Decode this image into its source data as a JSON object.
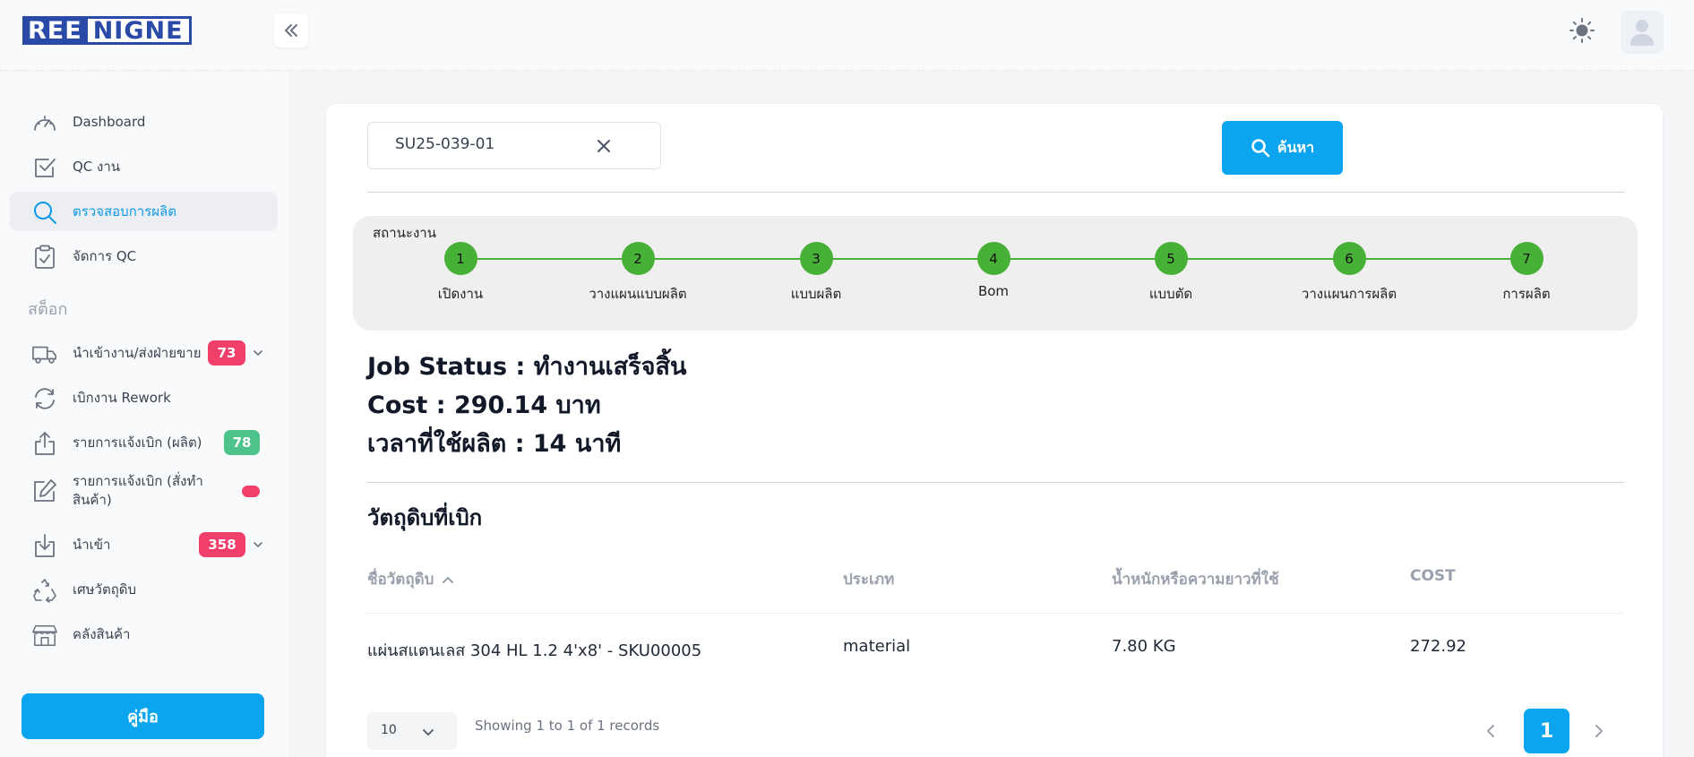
{
  "brand": {
    "logo_left": "REE",
    "logo_right": "NIGNE"
  },
  "sidebar": {
    "section_stock": "สต็อก",
    "items": [
      {
        "label": "Dashboard",
        "icon": "dashboard-gauge-icon"
      },
      {
        "label": "QC งาน",
        "icon": "checkbox-icon"
      },
      {
        "label": "ตรวจสอบการผลิต",
        "icon": "search-icon",
        "active": true
      },
      {
        "label": "จัดการ QC",
        "icon": "clipboard-icon"
      },
      {
        "label": "นำเข้างาน/ส่งฝ่ายขาย",
        "icon": "truck-icon",
        "badge": "73"
      },
      {
        "label": "เบิกงาน Rework",
        "icon": "refresh-icon"
      },
      {
        "label": "รายการแจ้งเบิก (ผลิต)",
        "icon": "upload-icon",
        "badge": "78"
      },
      {
        "label": "รายการแจ้งเบิก (สั่งทำสินค้า)",
        "icon": "edit-icon",
        "badge": ""
      },
      {
        "label": "นำเข้า",
        "icon": "download-icon",
        "badge": "358"
      },
      {
        "label": "เศษวัตถุดิบ",
        "icon": "recycle-icon"
      },
      {
        "label": "คลังสินค้า",
        "icon": "store-icon"
      }
    ],
    "manual_label": "คู่มือ"
  },
  "search": {
    "value": "SU25-039-01",
    "button_label": "ค้นหา"
  },
  "status": {
    "title": "สถานะงาน",
    "steps": [
      {
        "num": "1",
        "label": "เปิดงาน"
      },
      {
        "num": "2",
        "label": "วางแผนแบบผลิต"
      },
      {
        "num": "3",
        "label": "แบบผลิต"
      },
      {
        "num": "4",
        "label": "Bom"
      },
      {
        "num": "5",
        "label": "แบบตัด"
      },
      {
        "num": "6",
        "label": "วางแผนการผลิต"
      },
      {
        "num": "7",
        "label": "การผลิต"
      }
    ],
    "color": "#47b036"
  },
  "job": {
    "status_line": "Job Status : ทำงานเสร็จสิ้น",
    "cost_line": "Cost : 290.14 บาท",
    "time_line": "เวลาที่ใช้ผลิต : 14 นาที"
  },
  "materials": {
    "title": "วัตถุดิบที่เบิก",
    "columns": [
      "ชื่อวัตถุดิบ",
      "ประเภท",
      "น้ำหนักหรือความยาวที่ใช้",
      "COST"
    ],
    "rows": [
      [
        "แผ่นสแตนเลส 304 HL 1.2 4'x8' - SKU00005",
        "material",
        "7.80 KG",
        "272.92"
      ]
    ]
  },
  "pagination": {
    "per_page": "10",
    "records_text": "Showing 1 to 1 of 1 records",
    "current_page": "1"
  },
  "colors": {
    "accent": "#0ba5ef",
    "badge_red": "#ef3f6a",
    "badge_green": "#4cc38a",
    "brand_blue": "#2a4aa8"
  }
}
